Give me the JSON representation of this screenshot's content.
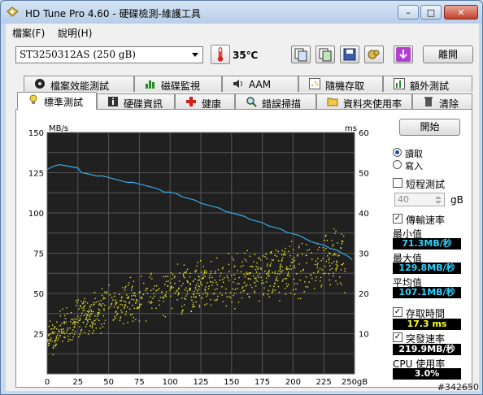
{
  "window": {
    "title": "HD Tune Pro 4.60 - 硬碟檢測-維護工具",
    "minimize_label": "–",
    "maximize_label": "□",
    "close_label": "✕"
  },
  "menu": [
    "檔案(F)",
    "說明(H)"
  ],
  "toolbar": {
    "drive": "ST3250312AS (250 gB)",
    "temperature": "35℃",
    "exit_label": "離開",
    "button_icons": [
      "copy-text-icon",
      "copy-screenshot-icon",
      "save-icon",
      "options-icon",
      "download-icon"
    ]
  },
  "tabs_top": [
    "檔案效能測試",
    "磁碟監視",
    "AAM",
    "隨機存取",
    "額外測試"
  ],
  "tabs_bottom": [
    "標準測試",
    "硬碟資訊",
    "健康",
    "錯誤掃描",
    "資料夾使用率",
    "清除"
  ],
  "active_tab": "標準測試",
  "controls": {
    "start_label": "開始",
    "read_label": "讀取",
    "write_label": "寫入",
    "mode_selected": "讀取",
    "short_test_label": "短程測試",
    "short_test_checked": false,
    "short_test_value": "40",
    "short_test_unit": "gB",
    "transfer_rate_label": "傳輸速率",
    "transfer_rate_checked": true,
    "min_label": "最小值",
    "min_value": "71.3MB/秒",
    "max_label": "最大值",
    "max_value": "129.8MB/秒",
    "avg_label": "平均值",
    "avg_value": "107.1MB/秒",
    "access_time_label": "存取時間",
    "access_time_checked": true,
    "access_time_value": "17.3 ms",
    "burst_rate_label": "突發速率",
    "burst_rate_checked": true,
    "burst_rate_value": "219.9MB/秒",
    "cpu_label": "CPU 使用率",
    "cpu_value": "3.0%"
  },
  "watermark": "#342650",
  "chart_data": {
    "type": "line",
    "background": "#1f1f1f",
    "grid": true,
    "y_left_unit": "MB/s",
    "y_right_unit": "ms",
    "y_left_ticks": [
      "150",
      "125",
      "100",
      "75",
      "50",
      "25"
    ],
    "y_right_ticks": [
      "60",
      "50",
      "40",
      "30",
      "20",
      "10"
    ],
    "x_ticks": [
      "0",
      "25",
      "50",
      "75",
      "100",
      "125",
      "150",
      "175",
      "200",
      "225",
      "250gB"
    ],
    "xlim": [
      0,
      250
    ],
    "ylim_left": [
      0,
      150
    ],
    "ylim_right": [
      0,
      60
    ],
    "series": [
      {
        "color": "#3aa9e6",
        "kind": "line",
        "x": [
          0,
          5,
          10,
          18,
          25,
          28,
          35,
          40,
          45,
          50,
          55,
          60,
          65,
          70,
          75,
          80,
          85,
          90,
          95,
          100,
          105,
          110,
          115,
          120,
          125,
          130,
          135,
          140,
          145,
          150,
          155,
          160,
          165,
          170,
          175,
          180,
          185,
          190,
          195,
          200,
          205,
          210,
          215,
          220,
          225,
          230,
          235,
          240,
          245,
          248
        ],
        "y": [
          127,
          129,
          130,
          129,
          128,
          125,
          124,
          123,
          123,
          122,
          121,
          120,
          119,
          119,
          118,
          117,
          116,
          115,
          113,
          113,
          112,
          110,
          109,
          108,
          106,
          105,
          104,
          103,
          101,
          100,
          99,
          98,
          96,
          95,
          94,
          92,
          91,
          90,
          88,
          87,
          86,
          84,
          82,
          81,
          80,
          78,
          77,
          75,
          73,
          71
        ]
      },
      {
        "color": "#e6e62a",
        "kind": "scatter",
        "axis": "right",
        "trend_x": [
          0,
          25,
          50,
          75,
          100,
          125,
          150,
          175,
          200,
          225,
          240
        ],
        "trend_y": [
          8.5,
          14,
          17,
          19,
          20.5,
          22,
          23.5,
          25,
          26.5,
          28,
          29
        ]
      }
    ]
  }
}
